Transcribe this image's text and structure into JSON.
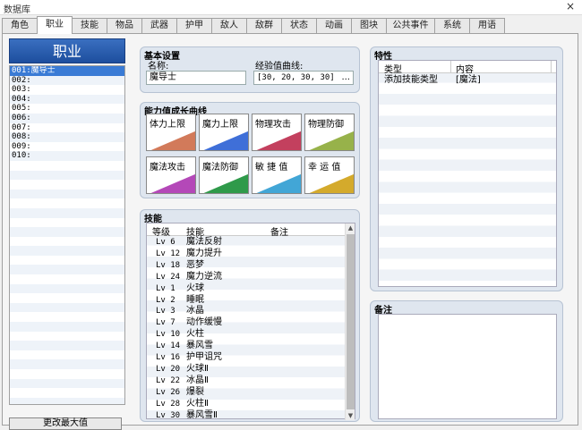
{
  "window": {
    "title": "数据库",
    "close": "×"
  },
  "tabs": [
    "角色",
    "职业",
    "技能",
    "物品",
    "武器",
    "护甲",
    "敌人",
    "敌群",
    "状态",
    "动画",
    "图块",
    "公共事件",
    "系统",
    "用语"
  ],
  "active_tab": 1,
  "class_list": {
    "header": "职业",
    "items": [
      "001:魔导士",
      "002:",
      "003:",
      "004:",
      "005:",
      "006:",
      "007:",
      "008:",
      "009:",
      "010:"
    ],
    "selected": 0,
    "button": "更改最大值"
  },
  "basic": {
    "title": "基本设置",
    "name_label": "名称:",
    "name_value": "魔导士",
    "exp_label": "经验值曲线:",
    "exp_value": "[30, 20, 30, 30]",
    "exp_button": "..."
  },
  "growth": {
    "title": "能力值成长曲线",
    "items": [
      {
        "label": "体力上限",
        "color": "#d27a5a"
      },
      {
        "label": "魔力上限",
        "color": "#3f6fd8"
      },
      {
        "label": "物理攻击",
        "color": "#c3405e"
      },
      {
        "label": "物理防御",
        "color": "#97b24a"
      },
      {
        "label": "魔法攻击",
        "color": "#b448b8"
      },
      {
        "label": "魔法防御",
        "color": "#2f9a4a"
      },
      {
        "label": "敏 捷 值",
        "color": "#42a6d6"
      },
      {
        "label": "幸 运 值",
        "color": "#d4aa2c"
      }
    ]
  },
  "skills": {
    "title": "技能",
    "columns": [
      "等级",
      "技能",
      "备注"
    ],
    "rows": [
      {
        "level": "Lv  6",
        "skill": "魔法反射"
      },
      {
        "level": "Lv 12",
        "skill": "魔力提升"
      },
      {
        "level": "Lv 18",
        "skill": "恶梦"
      },
      {
        "level": "Lv 24",
        "skill": "魔力逆流"
      },
      {
        "level": "Lv  1",
        "skill": "火球"
      },
      {
        "level": "Lv  2",
        "skill": "睡眠"
      },
      {
        "level": "Lv  3",
        "skill": "冰晶"
      },
      {
        "level": "Lv  7",
        "skill": "动作缓慢"
      },
      {
        "level": "Lv 10",
        "skill": "火柱"
      },
      {
        "level": "Lv 14",
        "skill": "暴风雪"
      },
      {
        "level": "Lv 16",
        "skill": "护甲诅咒"
      },
      {
        "level": "Lv 20",
        "skill": "火球Ⅱ"
      },
      {
        "level": "Lv 22",
        "skill": "冰晶Ⅱ"
      },
      {
        "level": "Lv 26",
        "skill": "爆裂"
      },
      {
        "level": "Lv 28",
        "skill": "火柱Ⅱ"
      },
      {
        "level": "Lv 30",
        "skill": "暴风雪Ⅱ"
      }
    ]
  },
  "traits": {
    "title": "特性",
    "columns": [
      "类型",
      "内容"
    ],
    "rows": [
      {
        "type": "添加技能类型",
        "content": "[魔法]"
      }
    ]
  },
  "note": {
    "title": "备注"
  }
}
